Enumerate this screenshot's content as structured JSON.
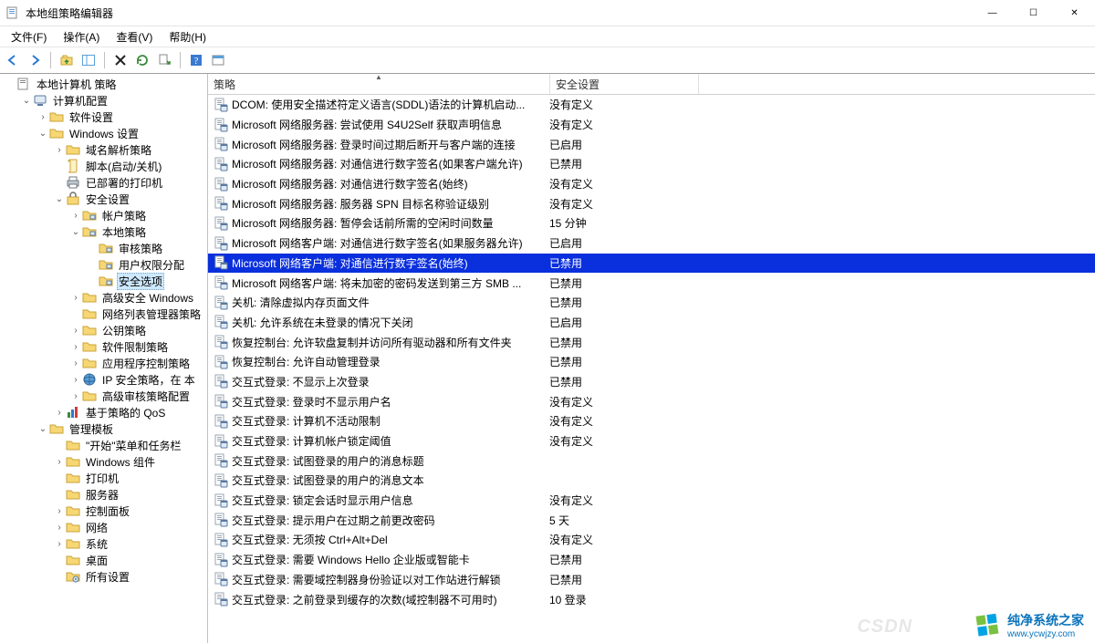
{
  "window": {
    "title": "本地组策略编辑器",
    "min": "—",
    "max": "☐",
    "close": "✕"
  },
  "menu": {
    "file": "文件(F)",
    "action": "操作(A)",
    "view": "查看(V)",
    "help": "帮助(H)"
  },
  "list": {
    "header_policy": "策略",
    "header_setting": "安全设置"
  },
  "tree": [
    {
      "d": 0,
      "expand": "",
      "icon": "book",
      "label": "本地计算机 策略"
    },
    {
      "d": 1,
      "expand": "open",
      "icon": "computer",
      "label": "计算机配置"
    },
    {
      "d": 2,
      "expand": "closed",
      "icon": "folder",
      "label": "软件设置"
    },
    {
      "d": 2,
      "expand": "open",
      "icon": "folder",
      "label": "Windows 设置"
    },
    {
      "d": 3,
      "expand": "closed",
      "icon": "folder",
      "label": "域名解析策略"
    },
    {
      "d": 3,
      "expand": "",
      "icon": "script",
      "label": "脚本(启动/关机)"
    },
    {
      "d": 3,
      "expand": "",
      "icon": "printer",
      "label": "已部署的打印机"
    },
    {
      "d": 3,
      "expand": "open",
      "icon": "security",
      "label": "安全设置"
    },
    {
      "d": 4,
      "expand": "closed",
      "icon": "folder-s",
      "label": "帐户策略"
    },
    {
      "d": 4,
      "expand": "open",
      "icon": "folder-s",
      "label": "本地策略"
    },
    {
      "d": 5,
      "expand": "",
      "icon": "folder-s",
      "label": "审核策略"
    },
    {
      "d": 5,
      "expand": "",
      "icon": "folder-s",
      "label": "用户权限分配"
    },
    {
      "d": 5,
      "expand": "",
      "icon": "folder-s",
      "label": "安全选项",
      "selected": true
    },
    {
      "d": 4,
      "expand": "closed",
      "icon": "folder",
      "label": "高级安全 Windows"
    },
    {
      "d": 4,
      "expand": "",
      "icon": "folder",
      "label": "网络列表管理器策略"
    },
    {
      "d": 4,
      "expand": "closed",
      "icon": "folder",
      "label": "公钥策略"
    },
    {
      "d": 4,
      "expand": "closed",
      "icon": "folder",
      "label": "软件限制策略"
    },
    {
      "d": 4,
      "expand": "closed",
      "icon": "folder",
      "label": "应用程序控制策略"
    },
    {
      "d": 4,
      "expand": "closed",
      "icon": "ipsec",
      "label": "IP 安全策略，在 本"
    },
    {
      "d": 4,
      "expand": "closed",
      "icon": "folder",
      "label": "高级审核策略配置"
    },
    {
      "d": 3,
      "expand": "closed",
      "icon": "stats",
      "label": "基于策略的 QoS"
    },
    {
      "d": 2,
      "expand": "open",
      "icon": "folder",
      "label": "管理模板"
    },
    {
      "d": 3,
      "expand": "",
      "icon": "folder",
      "label": "\"开始\"菜单和任务栏"
    },
    {
      "d": 3,
      "expand": "closed",
      "icon": "folder",
      "label": "Windows 组件"
    },
    {
      "d": 3,
      "expand": "",
      "icon": "folder",
      "label": "打印机"
    },
    {
      "d": 3,
      "expand": "",
      "icon": "folder",
      "label": "服务器"
    },
    {
      "d": 3,
      "expand": "closed",
      "icon": "folder",
      "label": "控制面板"
    },
    {
      "d": 3,
      "expand": "closed",
      "icon": "folder",
      "label": "网络"
    },
    {
      "d": 3,
      "expand": "closed",
      "icon": "folder",
      "label": "系统"
    },
    {
      "d": 3,
      "expand": "",
      "icon": "folder",
      "label": "桌面"
    },
    {
      "d": 3,
      "expand": "",
      "icon": "folderset",
      "label": "所有设置"
    }
  ],
  "rows": [
    {
      "policy": "DCOM: 使用安全描述符定义语言(SDDL)语法的计算机启动...",
      "setting": "没有定义"
    },
    {
      "policy": "Microsoft 网络服务器: 尝试使用 S4U2Self 获取声明信息",
      "setting": "没有定义"
    },
    {
      "policy": "Microsoft 网络服务器: 登录时间过期后断开与客户端的连接",
      "setting": "已启用"
    },
    {
      "policy": "Microsoft 网络服务器: 对通信进行数字签名(如果客户端允许)",
      "setting": "已禁用"
    },
    {
      "policy": "Microsoft 网络服务器: 对通信进行数字签名(始终)",
      "setting": "没有定义"
    },
    {
      "policy": "Microsoft 网络服务器: 服务器 SPN 目标名称验证级别",
      "setting": "没有定义"
    },
    {
      "policy": "Microsoft 网络服务器: 暂停会话前所需的空闲时间数量",
      "setting": "15 分钟"
    },
    {
      "policy": "Microsoft 网络客户端: 对通信进行数字签名(如果服务器允许)",
      "setting": "已启用"
    },
    {
      "policy": "Microsoft 网络客户端: 对通信进行数字签名(始终)",
      "setting": "已禁用",
      "selected": true
    },
    {
      "policy": "Microsoft 网络客户端: 将未加密的密码发送到第三方 SMB ...",
      "setting": "已禁用"
    },
    {
      "policy": "关机: 清除虚拟内存页面文件",
      "setting": "已禁用"
    },
    {
      "policy": "关机: 允许系统在未登录的情况下关闭",
      "setting": "已启用"
    },
    {
      "policy": "恢复控制台: 允许软盘复制并访问所有驱动器和所有文件夹",
      "setting": "已禁用"
    },
    {
      "policy": "恢复控制台: 允许自动管理登录",
      "setting": "已禁用"
    },
    {
      "policy": "交互式登录: 不显示上次登录",
      "setting": "已禁用"
    },
    {
      "policy": "交互式登录: 登录时不显示用户名",
      "setting": "没有定义"
    },
    {
      "policy": "交互式登录: 计算机不活动限制",
      "setting": "没有定义"
    },
    {
      "policy": "交互式登录: 计算机帐户锁定阈值",
      "setting": "没有定义"
    },
    {
      "policy": "交互式登录: 试图登录的用户的消息标题",
      "setting": ""
    },
    {
      "policy": "交互式登录: 试图登录的用户的消息文本",
      "setting": ""
    },
    {
      "policy": "交互式登录: 锁定会话时显示用户信息",
      "setting": "没有定义"
    },
    {
      "policy": "交互式登录: 提示用户在过期之前更改密码",
      "setting": "5 天"
    },
    {
      "policy": "交互式登录: 无须按 Ctrl+Alt+Del",
      "setting": "没有定义"
    },
    {
      "policy": "交互式登录: 需要 Windows Hello 企业版或智能卡",
      "setting": "已禁用"
    },
    {
      "policy": "交互式登录: 需要域控制器身份验证以对工作站进行解锁",
      "setting": "已禁用"
    },
    {
      "policy": "交互式登录: 之前登录到缓存的次数(域控制器不可用时)",
      "setting": "10 登录"
    }
  ],
  "watermark": {
    "csdn": "CSDN",
    "brand": "纯净系统之家",
    "url": "www.ycwjzy.com"
  }
}
